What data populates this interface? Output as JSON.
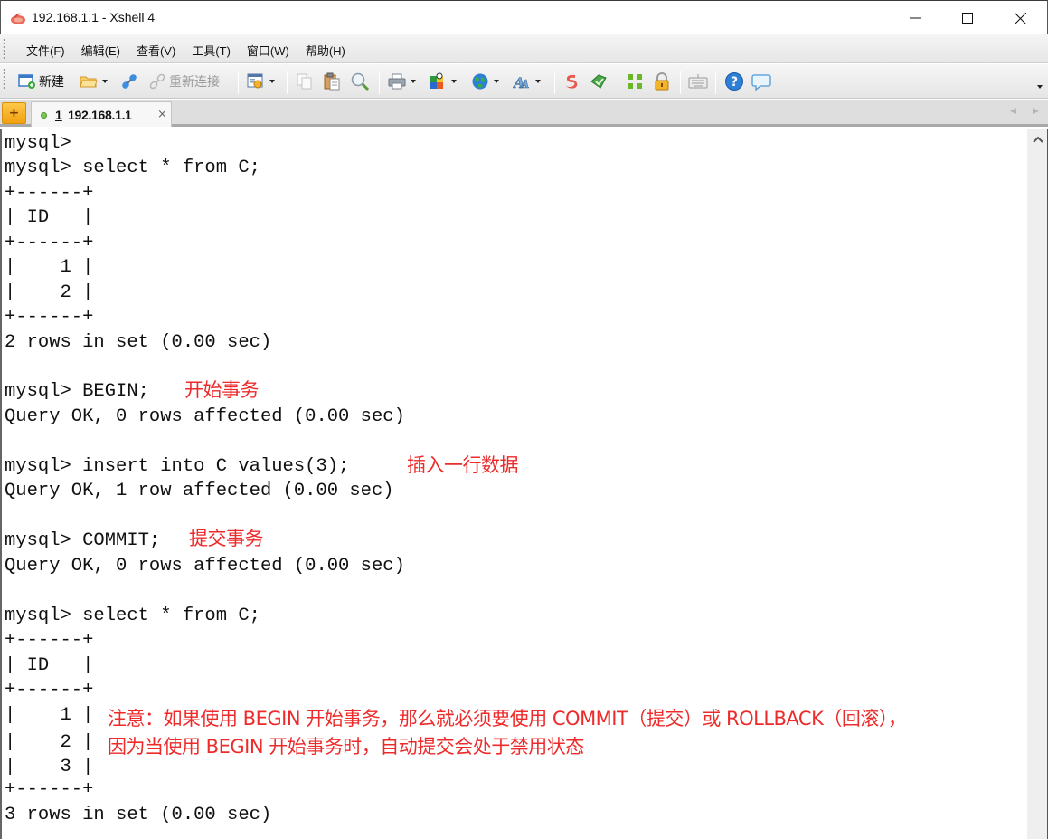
{
  "window": {
    "title": "192.168.1.1 - Xshell 4",
    "controls": {
      "minimize": "minimize",
      "maximize": "maximize",
      "close": "close"
    }
  },
  "menubar": {
    "items": [
      {
        "label": "文件(F)"
      },
      {
        "label": "编辑(E)"
      },
      {
        "label": "查看(V)"
      },
      {
        "label": "工具(T)"
      },
      {
        "label": "窗口(W)"
      },
      {
        "label": "帮助(H)"
      }
    ]
  },
  "toolbar": {
    "new_label": "新建",
    "reconnect_label": "重新连接",
    "icons": [
      "new-session-icon",
      "open-folder-icon",
      "connect-icon",
      "reconnect-icon",
      "properties-icon",
      "copy-icon",
      "paste-icon",
      "find-icon",
      "print-icon",
      "color-scheme-icon",
      "encoding-globe-icon",
      "font-icon",
      "xftp-icon",
      "xagent-icon",
      "fullscreen-icon",
      "lock-icon",
      "keyboard-icon",
      "help-icon",
      "chat-icon"
    ]
  },
  "tabs": [
    {
      "number": "1",
      "label": "192.168.1.1",
      "status": "connected",
      "close": "×"
    }
  ],
  "terminal": {
    "lines": [
      "mysql>",
      "mysql> select * from C;",
      "+------+",
      "| ID   |",
      "+------+",
      "|    1 |",
      "|    2 |",
      "+------+",
      "2 rows in set (0.00 sec)",
      "",
      "mysql> BEGIN;",
      "Query OK, 0 rows affected (0.00 sec)",
      "",
      "mysql> insert into C values(3);",
      "Query OK, 1 row affected (0.00 sec)",
      "",
      "mysql> COMMIT;",
      "Query OK, 0 rows affected (0.00 sec)",
      "",
      "mysql> select * from C;",
      "+------+",
      "| ID   |",
      "+------+",
      "|    1 |",
      "|    2 |",
      "|    3 |",
      "+------+",
      "3 rows in set (0.00 sec)"
    ],
    "annotations": {
      "begin": "开始事务",
      "insert": "插入一行数据",
      "commit": "提交事务",
      "note_line1": "注意：如果使用 BEGIN 开始事务，那么就必须要使用 COMMIT（提交）或 ROLLBACK（回滚），",
      "note_line2": "因为当使用 BEGIN 开始事务时，自动提交会处于禁用状态"
    },
    "annotation_color": "#ee2b2b"
  }
}
